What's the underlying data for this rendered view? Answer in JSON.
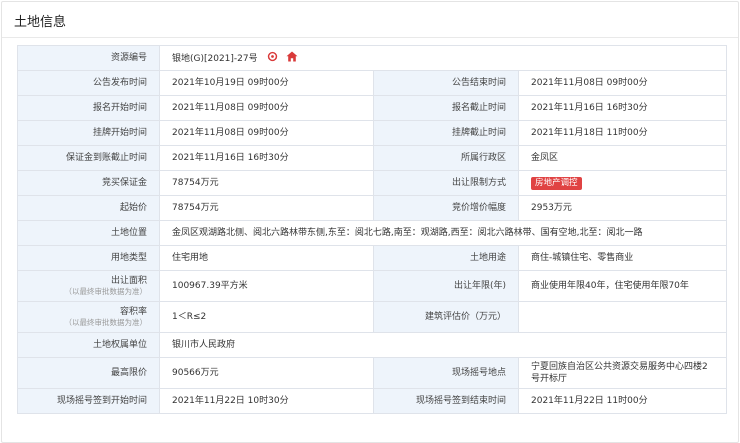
{
  "panel": {
    "title": "土地信息"
  },
  "colors": {
    "label_bg": "#eef4fb",
    "border": "#dfe3ea",
    "icon_accent": "#d93a3a",
    "badge_bg": "#e04343"
  },
  "icons": {
    "resource_action_1": "gear-icon",
    "resource_action_2": "home-icon"
  },
  "fields": {
    "resource_code": {
      "label": "资源编号",
      "value": "银地(G)[2021]-27号"
    },
    "announce_start": {
      "label": "公告发布时间",
      "value": "2021年10月19日 09时00分"
    },
    "announce_end": {
      "label": "公告结束时间",
      "value": "2021年11月08日 09时00分"
    },
    "signup_start": {
      "label": "报名开始时间",
      "value": "2021年11月08日 09时00分"
    },
    "signup_end": {
      "label": "报名截止时间",
      "value": "2021年11月16日 16时30分"
    },
    "listing_start": {
      "label": "挂牌开始时间",
      "value": "2021年11月08日 09时00分"
    },
    "listing_end": {
      "label": "挂牌截止时间",
      "value": "2021年11月18日 11时00分"
    },
    "deposit_deadline": {
      "label": "保证金到账截止时间",
      "value": "2021年11月16日 16时30分"
    },
    "district": {
      "label": "所属行政区",
      "value": "金凤区"
    },
    "deposit": {
      "label": "竞买保证金",
      "value": "78754万元"
    },
    "transfer_restriction": {
      "label": "出让限制方式",
      "value": "房地产调控"
    },
    "starting_price": {
      "label": "起始价",
      "value": "78754万元"
    },
    "bid_increment": {
      "label": "竞价增价幅度",
      "value": "2953万元"
    },
    "location": {
      "label": "土地位置",
      "value": "金凤区观湖路北侧、阅北六路林带东侧,东至：阅北七路,南至：观湖路,西至：阅北六路林带、国有空地,北至：阅北一路"
    },
    "land_type": {
      "label": "用地类型",
      "value": "住宅用地"
    },
    "land_use": {
      "label": "土地用途",
      "value": "商住-城镇住宅、零售商业"
    },
    "area": {
      "label": "出让面积",
      "note": "（以最终审批数据为准）",
      "value": "100967.39平方米"
    },
    "term": {
      "label": "出让年限(年)",
      "value": "商业使用年限40年，住宅使用年限70年"
    },
    "plot_ratio": {
      "label": "容积率",
      "note": "（以最终审批数据为准）",
      "value": "1＜R≤2"
    },
    "building_valuation": {
      "label": "建筑评估价（万元）",
      "value": ""
    },
    "ownership_unit": {
      "label": "土地权属单位",
      "value": "银川市人民政府"
    },
    "max_price": {
      "label": "最高限价",
      "value": "90566万元"
    },
    "lottery_location": {
      "label": "现场摇号地点",
      "value": "宁夏回族自治区公共资源交易服务中心四楼2号开标厅"
    },
    "lottery_signin_start": {
      "label": "现场摇号签到开始时间",
      "value": "2021年11月22日 10时30分"
    },
    "lottery_signin_end": {
      "label": "现场摇号签到结束时间",
      "value": "2021年11月22日 11时00分"
    }
  }
}
